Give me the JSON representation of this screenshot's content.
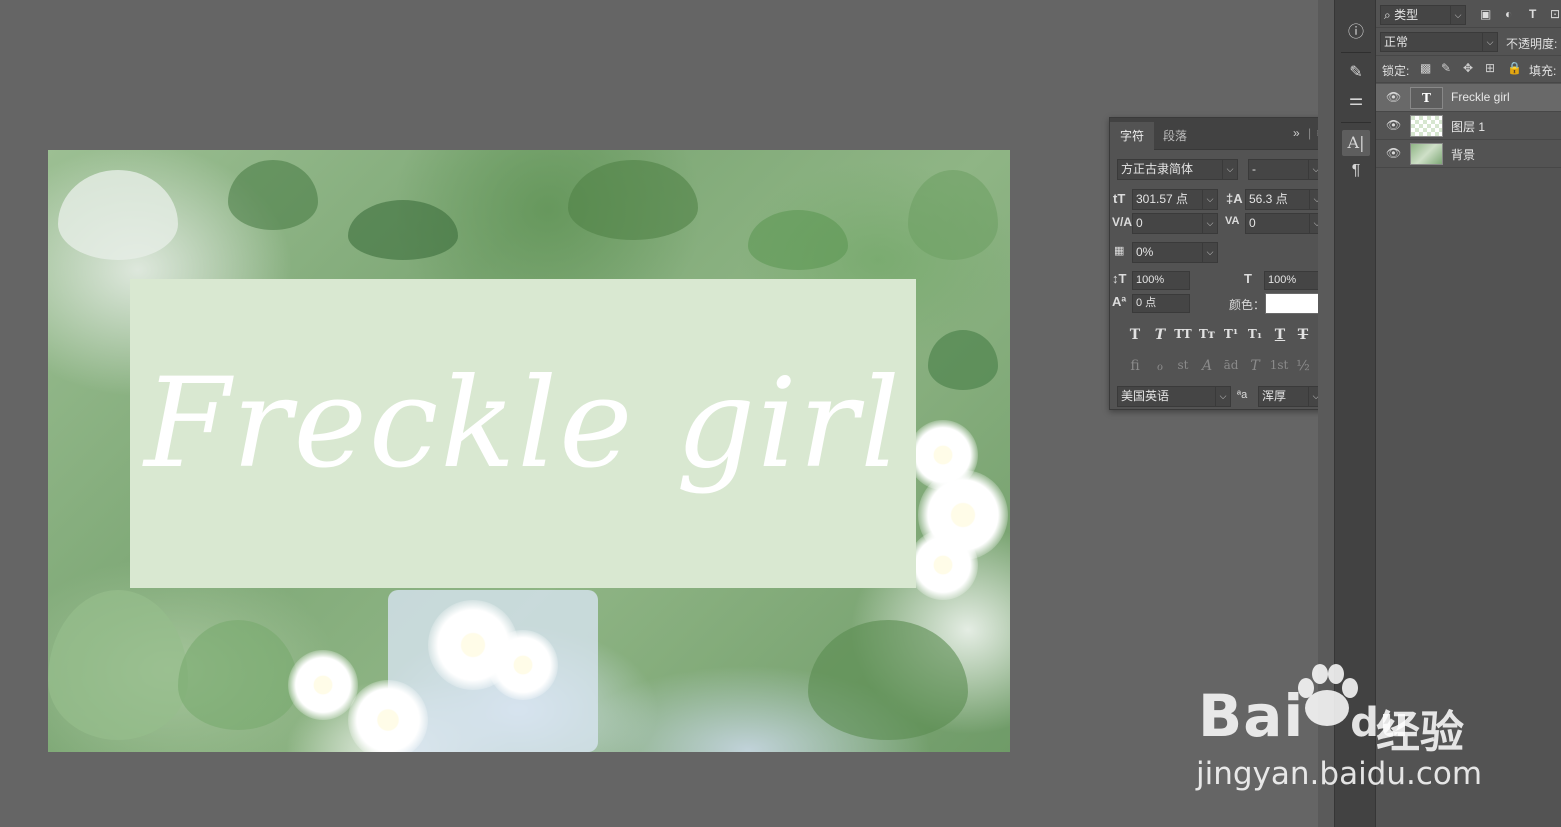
{
  "canvas": {
    "text_layer": "Freckle girl",
    "box_color": "#d9e8d1"
  },
  "character_panel": {
    "tabs": [
      "字符",
      "段落"
    ],
    "active_tab": "字符",
    "expand_glyph": "»",
    "menu_glyph": "≡",
    "font_family": "方正古隶简体",
    "font_style": "-",
    "font_size": "301.57 点",
    "leading": "56.3 点",
    "kerning": "0",
    "tracking": "0",
    "tsume": "0%",
    "vertical_scale": "100%",
    "horizontal_scale": "100%",
    "baseline_shift": "0 点",
    "color_label": "颜色：",
    "color_value": "#ffffff",
    "language": "美国英语",
    "antialias_label": "ªa",
    "antialias": "浑厚",
    "style_buttons": [
      "T",
      "T",
      "TT",
      "Tт",
      "T¹",
      "T₁",
      "T",
      "T"
    ],
    "opentype_buttons": [
      "fi",
      "ℴ",
      "st",
      "A",
      "ād",
      "T",
      "1st",
      "½"
    ]
  },
  "dock": {
    "icons": [
      "info-icon",
      "brush-settings-icon",
      "adjustments-icon",
      "character-icon",
      "paragraph-icon"
    ]
  },
  "layers_panel": {
    "filter_label": "类型",
    "blend_mode": "正常",
    "opacity_label": "不透明度:",
    "lock_label": "锁定:",
    "fill_label": "填充:",
    "layers": [
      {
        "name": "Freckle girl",
        "type": "text",
        "selected": true,
        "thumb": "T"
      },
      {
        "name": "图层 1",
        "type": "pixel",
        "selected": false,
        "thumb": ""
      },
      {
        "name": "背景",
        "type": "background",
        "selected": false,
        "thumb": ""
      }
    ]
  },
  "watermark": {
    "brand": "Bai",
    "brand_suffix": "du",
    "brand_cn": "经验",
    "url": "jingyan.baidu.com"
  }
}
